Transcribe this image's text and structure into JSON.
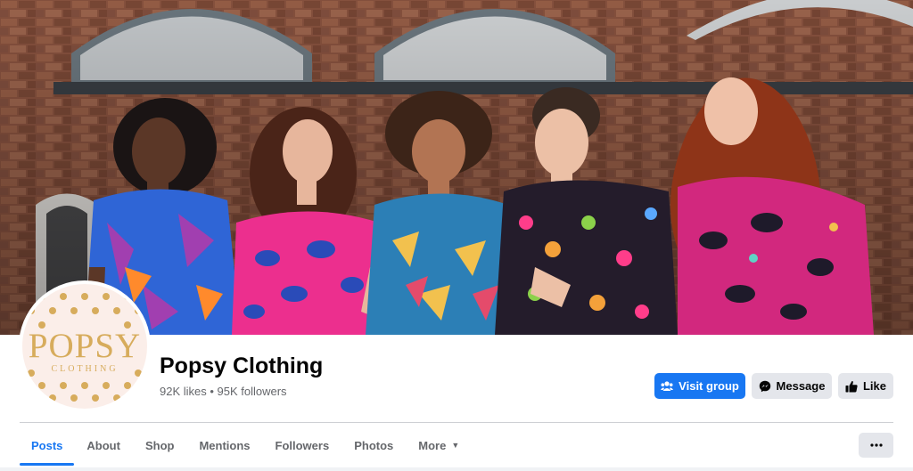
{
  "cover": {
    "alt": "Cover photo"
  },
  "page": {
    "name": "Popsy Clothing",
    "stats": "92K likes • 95K followers"
  },
  "logo": {
    "word": "POPSY",
    "sub": "CLOTHING"
  },
  "actions": {
    "visit_group": "Visit group",
    "message": "Message",
    "like": "Like"
  },
  "tabs": [
    {
      "label": "Posts",
      "active": true
    },
    {
      "label": "About"
    },
    {
      "label": "Shop"
    },
    {
      "label": "Mentions"
    },
    {
      "label": "Followers"
    },
    {
      "label": "Photos"
    },
    {
      "label": "More"
    }
  ],
  "colors": {
    "accent": "#1877f2",
    "secondary_btn": "#e4e6eb",
    "logo_gold": "#d7ac5c",
    "logo_bg": "#fbeee9"
  },
  "icons": {
    "visit_group": "group-icon",
    "message": "messenger-icon",
    "like": "thumbs-up-icon",
    "more": "ellipsis-icon",
    "tab_more": "caret-down-icon"
  }
}
